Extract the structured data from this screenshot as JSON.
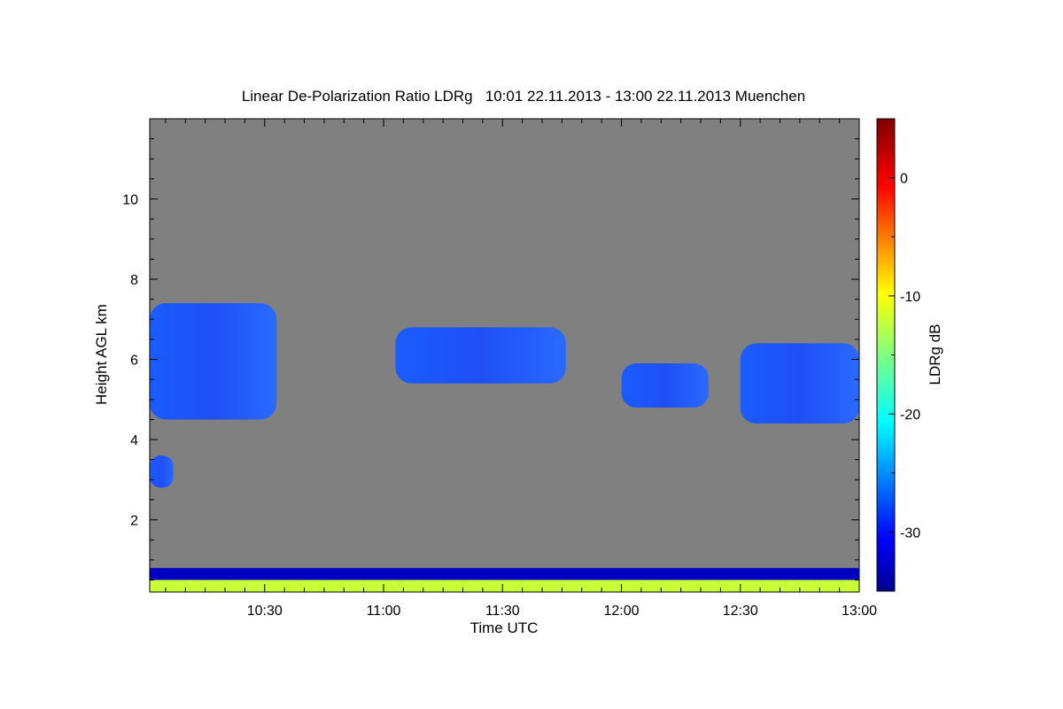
{
  "chart_data": {
    "type": "heatmap",
    "title": "Linear De-Polarization Ratio LDRg   10:01 22.11.2013 - 13:00 22.11.2013 Muenchen",
    "xlabel": "Time UTC",
    "ylabel": "Height AGL km",
    "colorbar_label": "LDRg dB",
    "x_range": [
      "10:01",
      "13:00"
    ],
    "y_range": [
      0.2,
      12.0
    ],
    "x_ticks": [
      "10:30",
      "11:00",
      "11:30",
      "12:00",
      "12:30",
      "13:00"
    ],
    "y_ticks": [
      "2",
      "4",
      "6",
      "8",
      "10"
    ],
    "colorbar_range": [
      -35,
      5
    ],
    "colorbar_ticks": [
      "0",
      "-10",
      "-20",
      "-30"
    ],
    "colormap": "jet",
    "background_color": "#808080",
    "features": [
      {
        "time_start": "10:01",
        "time_end": "10:33",
        "height_bottom": 4.5,
        "height_top": 7.4,
        "ldr_db": -31
      },
      {
        "time_start": "11:03",
        "time_end": "11:46",
        "height_bottom": 5.4,
        "height_top": 6.8,
        "ldr_db": -31
      },
      {
        "time_start": "12:00",
        "time_end": "12:22",
        "height_bottom": 4.8,
        "height_top": 5.9,
        "ldr_db": -31
      },
      {
        "time_start": "12:30",
        "time_end": "13:00",
        "height_bottom": 4.4,
        "height_top": 6.4,
        "ldr_db": -31
      },
      {
        "time_start": "10:01",
        "time_end": "10:07",
        "height_bottom": 2.8,
        "height_top": 3.6,
        "ldr_db": -32
      },
      {
        "time_start": "10:01",
        "time_end": "13:00",
        "height_bottom": 0.5,
        "height_top": 0.8,
        "ldr_db": -33
      },
      {
        "time_start": "10:01",
        "time_end": "13:00",
        "height_bottom": 0.2,
        "height_top": 0.5,
        "ldr_db": -12
      }
    ]
  }
}
